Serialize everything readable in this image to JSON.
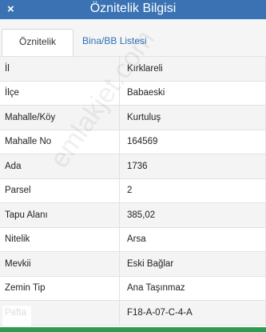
{
  "header": {
    "close_glyph": "×",
    "title": "Öznitelik Bilgisi"
  },
  "tabs": [
    {
      "label": "Öznitelik Bilgisi"
    },
    {
      "label": "Bina/BB Listesi"
    }
  ],
  "rows": [
    {
      "key": "İl",
      "value": "Kırklareli"
    },
    {
      "key": "İlçe",
      "value": "Babaeski"
    },
    {
      "key": "Mahalle/Köy",
      "value": "Kurtuluş"
    },
    {
      "key": "Mahalle No",
      "value": "164569"
    },
    {
      "key": "Ada",
      "value": "1736"
    },
    {
      "key": "Parsel",
      "value": "2"
    },
    {
      "key": "Tapu Alanı",
      "value": "385,02"
    },
    {
      "key": "Nitelik",
      "value": "Arsa"
    },
    {
      "key": "Mevkii",
      "value": "Eski Bağlar"
    },
    {
      "key": "Zemin Tip",
      "value": "Ana Taşınmaz"
    },
    {
      "key": "Pafta",
      "value": "F18-A-07-C-4-A"
    }
  ],
  "watermark": "emlakjet.com",
  "colors": {
    "header": "#3a72b3",
    "tab_link": "#2d6fb5",
    "bottom_bar": "#2e9c4f"
  }
}
